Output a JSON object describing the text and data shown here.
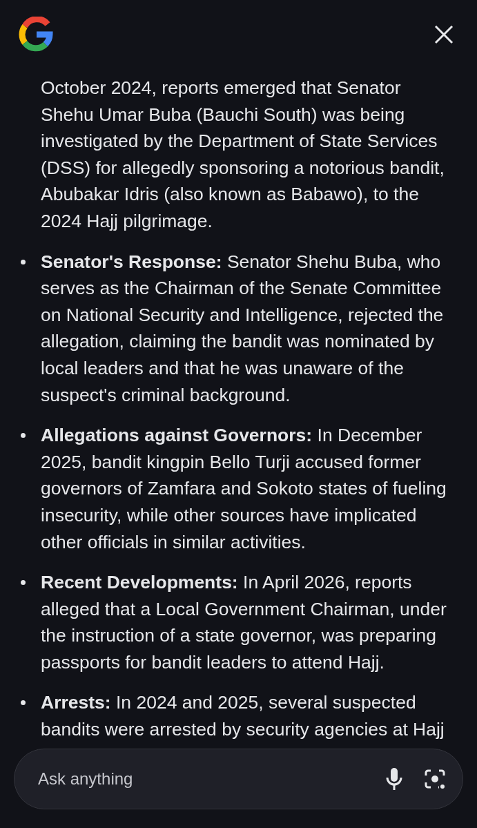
{
  "intro": "October 2024, reports emerged that Senator Shehu Umar Buba (Bauchi South) was being investigated by the Department of State Services (DSS) for allegedly sponsoring a notorious bandit, Abubakar Idris (also known as Babawo), to the 2024 Hajj pilgrimage.",
  "bullets": [
    {
      "text": "**Senator's Response:** Senator Shehu Buba, who serves as the Chairman of the Senate Committee on National Security and Intelligence, rejected the allegation, claiming the bandit was nominated by local leaders and that he was unaware of the suspect's criminal background."
    },
    {
      "text": "**Allegations against Governors:** In December 2025, bandit kingpin Bello Turji accused former governors of Zamfara and Sokoto states of fueling insecurity, while other sources have implicated other officials in similar activities."
    },
    {
      "text": "**Recent Developments:** In April 2026, reports alleged that a Local Government Chairman, under the instruction of a state governor, was preparing passports for bandit leaders to attend Hajj."
    },
    {
      "text": "**Arrests:** In 2024 and 2025, several suspected bandits were arrested by security agencies at Hajj"
    }
  ],
  "search": {
    "placeholder": "Ask anything"
  }
}
